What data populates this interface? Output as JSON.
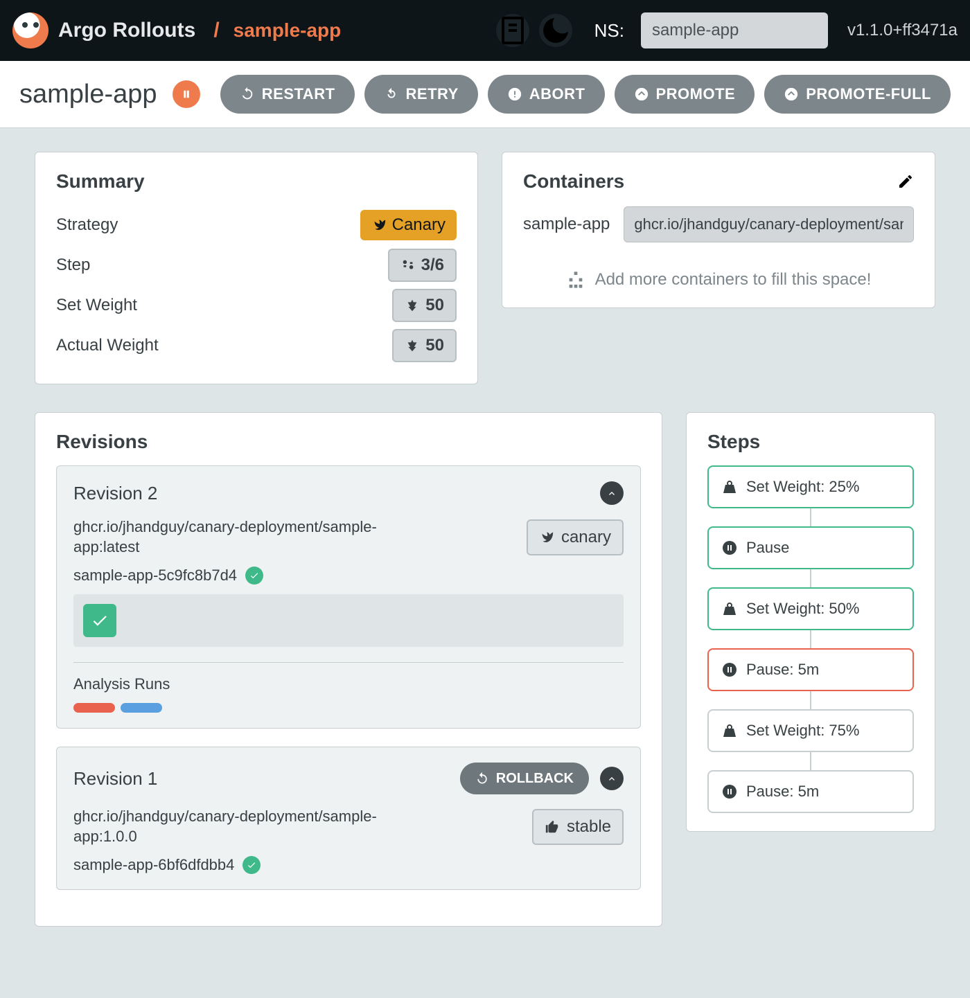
{
  "header": {
    "brand": "Argo Rollouts",
    "breadcrumb_sep": "/",
    "breadcrumb_app": "sample-app",
    "ns_label": "NS:",
    "ns_value": "sample-app",
    "version": "v1.1.0+ff3471a"
  },
  "page": {
    "title": "sample-app",
    "status": "paused",
    "actions": {
      "restart": "RESTART",
      "retry": "RETRY",
      "abort": "ABORT",
      "promote": "PROMOTE",
      "promote_full": "PROMOTE-FULL"
    }
  },
  "summary": {
    "title": "Summary",
    "strategy_label": "Strategy",
    "strategy_value": "Canary",
    "step_label": "Step",
    "step_value": "3/6",
    "set_weight_label": "Set Weight",
    "set_weight_value": "50",
    "actual_weight_label": "Actual Weight",
    "actual_weight_value": "50"
  },
  "containers": {
    "title": "Containers",
    "items": [
      {
        "name": "sample-app",
        "image": "ghcr.io/jhandguy/canary-deployment/sample-app:latest"
      }
    ],
    "empty_hint": "Add more containers to fill this space!"
  },
  "revisions": {
    "title": "Revisions",
    "list": [
      {
        "title": "Revision 2",
        "image": "ghcr.io/jhandguy/canary-deployment/sample-app:latest",
        "tag": "canary",
        "replicaset": "sample-app-5c9fc8b7d4",
        "analysis_title": "Analysis Runs",
        "show_rollback": false
      },
      {
        "title": "Revision 1",
        "image": "ghcr.io/jhandguy/canary-deployment/sample-app:1.0.0",
        "tag": "stable",
        "replicaset": "sample-app-6bf6dfdbb4",
        "rollback_label": "ROLLBACK",
        "show_rollback": true
      }
    ]
  },
  "steps": {
    "title": "Steps",
    "list": [
      {
        "label": "Set Weight: 25%",
        "state": "done",
        "icon": "weight"
      },
      {
        "label": "Pause",
        "state": "done",
        "icon": "pause"
      },
      {
        "label": "Set Weight: 50%",
        "state": "done",
        "icon": "weight"
      },
      {
        "label": "Pause: 5m",
        "state": "current",
        "icon": "pause"
      },
      {
        "label": "Set Weight: 75%",
        "state": "pending",
        "icon": "weight"
      },
      {
        "label": "Pause: 5m",
        "state": "pending",
        "icon": "pause"
      }
    ]
  }
}
